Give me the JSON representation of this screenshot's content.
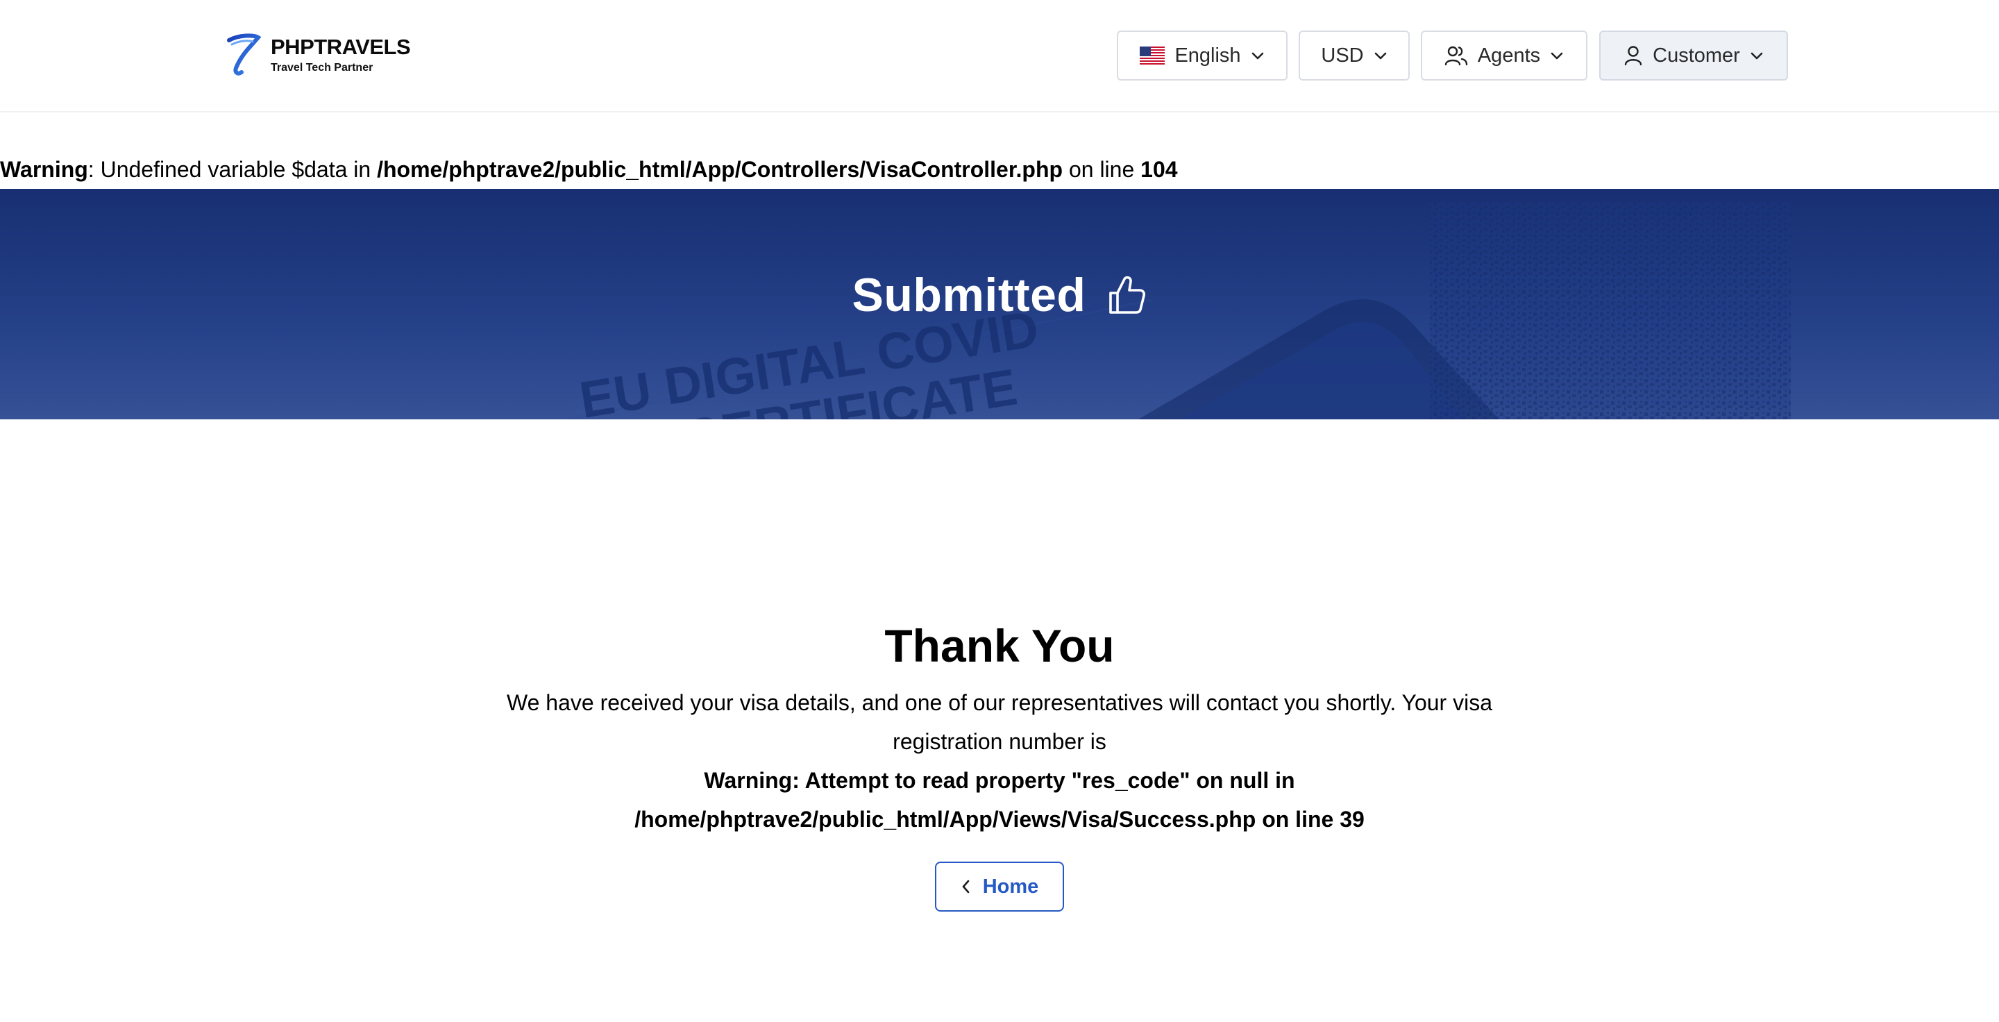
{
  "header": {
    "logo_name": "PHPTRAVELS",
    "logo_tagline": "Travel Tech Partner",
    "language_label": "English",
    "currency_label": "USD",
    "agents_label": "Agents",
    "customer_label": "Customer"
  },
  "warning_top": {
    "prefix": "Warning",
    "text": ": Undefined variable $data in ",
    "path": "/home/phptrave2/public_html/App/Controllers/VisaController.php",
    "on_line": " on line ",
    "line": "104"
  },
  "banner": {
    "title": "Submitted",
    "background_text_1": "EU DIGITAL COVID",
    "background_text_2": "CERTIFICATE"
  },
  "content": {
    "thanks_title": "Thank You",
    "message": "We have received your visa details, and one of our representatives will contact you shortly. Your visa registration number is",
    "warning_line1": "Warning: Attempt to read property \"res_code\" on null in",
    "warning_line2": "/home/phptrave2/public_html/App/Views/Visa/Success.php on line 39",
    "home_button": "Home"
  },
  "colors": {
    "banner": "#1d3a84",
    "accent": "#2559c4",
    "customer_bg": "#eef2f7"
  },
  "icons": [
    "phptravels-logo-icon",
    "us-flag-icon",
    "chevron-down-icon",
    "users-icon",
    "user-icon",
    "thumbs-up-icon",
    "chevron-left-icon"
  ]
}
